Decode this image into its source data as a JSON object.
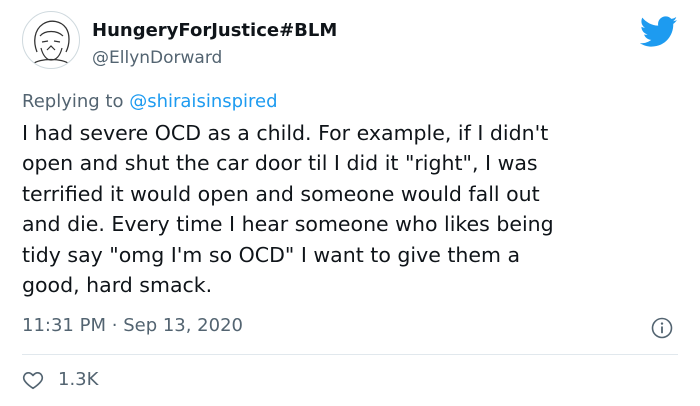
{
  "tweet": {
    "display_name": "HungeryForJustice#BLM",
    "handle": "@EllynDorward",
    "replying_prefix": "Replying to",
    "replying_to": "@shiraisinspired",
    "body_lines": [
      "I had severe OCD as a child.  For example, if I didn't",
      "open and shut the car door til I did it \"right\", I was",
      "terrified it would open and someone would fall out",
      "and die.  Every time I hear someone who likes being",
      "tidy say \"omg I'm so OCD\" I want to give them a",
      "good, hard smack."
    ],
    "time": "11:31 PM",
    "separator": "·",
    "date": "Sep 13, 2020",
    "like_count": "1.3K"
  },
  "colors": {
    "brand_blue": "#1d9bf0",
    "secondary_text": "#536471",
    "primary_text": "#0f1419"
  },
  "icons": {
    "logo": "twitter-bird-icon",
    "info": "info-icon",
    "like": "heart-icon"
  }
}
